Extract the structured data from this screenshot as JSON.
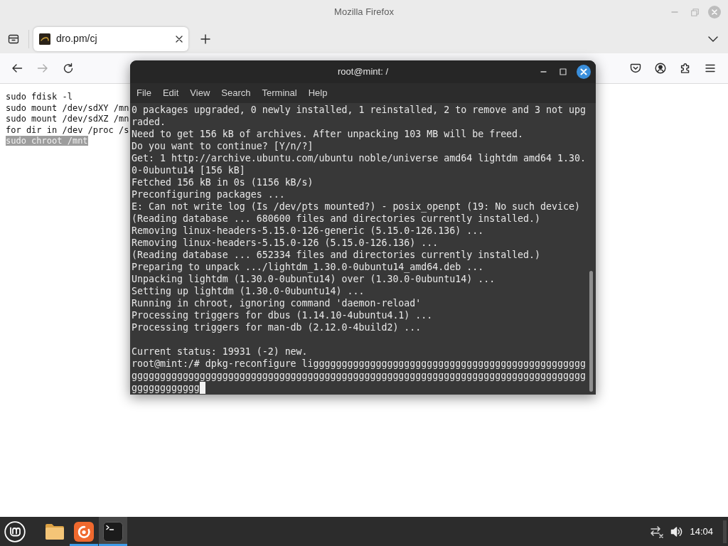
{
  "browser": {
    "title": "Mozilla Firefox",
    "tabs": [
      {
        "title": "dro.pm/cj",
        "selected": true
      }
    ],
    "nav_buttons": [
      {
        "kind": "back",
        "disabled": false
      },
      {
        "kind": "forward",
        "disabled": true
      },
      {
        "kind": "reload",
        "disabled": false
      }
    ],
    "toolbar_buttons": [
      {
        "kind": "pocket"
      },
      {
        "kind": "account"
      },
      {
        "kind": "extensions"
      },
      {
        "kind": "menu"
      }
    ]
  },
  "page": {
    "lines": [
      {
        "text": "sudo fdisk -l",
        "selected": false
      },
      {
        "text": "sudo mount /dev/sdXY /mn",
        "selected": false
      },
      {
        "text": "sudo mount /dev/sdXZ /mn",
        "selected": false
      },
      {
        "text": "for dir in /dev /proc /s",
        "selected": false
      },
      {
        "text": "sudo chroot /mnt",
        "selected": true
      }
    ]
  },
  "terminal": {
    "title": "root@mint: /",
    "menu": [
      "File",
      "Edit",
      "View",
      "Search",
      "Terminal",
      "Help"
    ],
    "blocks": [
      {
        "lines": [
          "0 packages upgraded, 0 newly installed, 1 reinstalled, 2 to remove and 3 not upg",
          "raded.",
          "Need to get 156 kB of archives. After unpacking 103 MB will be freed.",
          "Do you want to continue? [Y/n/?]",
          "Get: 1 http://archive.ubuntu.com/ubuntu noble/universe amd64 lightdm amd64 1.30.",
          "0-0ubuntu14 [156 kB]",
          "Fetched 156 kB in 0s (1156 kB/s)",
          "Preconfiguring packages ...",
          "E: Can not write log (Is /dev/pts mounted?) - posix_openpt (19: No such device)",
          "(Reading database ... 680600 files and directories currently installed.)",
          "Removing linux-headers-5.15.0-126-generic (5.15.0-126.136) ...",
          "Removing linux-headers-5.15.0-126 (5.15.0-126.136) ...",
          "(Reading database ... 652334 files and directories currently installed.)",
          "Preparing to unpack .../lightdm_1.30.0-0ubuntu14_amd64.deb ...",
          "Unpacking lightdm (1.30.0-0ubuntu14) over (1.30.0-0ubuntu14) ...",
          "Setting up lightdm (1.30.0-0ubuntu14) ...",
          "Running in chroot, ignoring command 'daemon-reload'",
          "Processing triggers for dbus (1.14.10-4ubuntu4.1) ...",
          "Processing triggers for man-db (2.12.0-4build2) ..."
        ]
      },
      {
        "lines": [
          "Current status: 19931 (-2) new.",
          "root@mint:/# dpkg-reconfigure ligggggggggggggggggggggggggggggggggggggggggggggggg",
          "gggggggggggggggggggggggggggggggggggggggggggggggggggggggggggggggggggggggggggggggg",
          "gggggggggggg"
        ]
      }
    ]
  },
  "taskbar": {
    "apps": [
      {
        "kind": "files",
        "running": false,
        "focused": false
      },
      {
        "kind": "firefox",
        "running": true,
        "focused": false
      },
      {
        "kind": "terminal",
        "running": true,
        "focused": true
      }
    ],
    "network_connected": false,
    "clock": "14:04"
  }
}
